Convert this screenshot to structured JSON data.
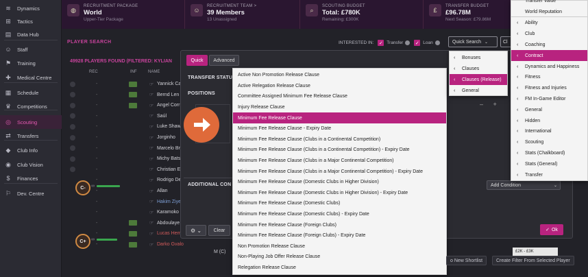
{
  "sidebar": {
    "items": [
      {
        "label": "Dynamics",
        "icon": "dynamics-icon",
        "glyph": "≋"
      },
      {
        "label": "Tactics",
        "icon": "tactics-icon",
        "glyph": "⊞"
      },
      {
        "label": "Data Hub",
        "icon": "data-hub-icon",
        "glyph": "▤"
      },
      {
        "label": "Staff",
        "icon": "staff-icon",
        "glyph": "☺"
      },
      {
        "label": "Training",
        "icon": "training-icon",
        "glyph": "⚑"
      },
      {
        "label": "Medical Centre",
        "icon": "medical-icon",
        "glyph": "✚"
      },
      {
        "label": "Schedule",
        "icon": "schedule-icon",
        "glyph": "▦"
      },
      {
        "label": "Competitions",
        "icon": "trophy-icon",
        "glyph": "♛"
      },
      {
        "label": "Scouting",
        "icon": "scouting-icon",
        "glyph": "◎"
      },
      {
        "label": "Transfers",
        "icon": "transfers-icon",
        "glyph": "⇄"
      },
      {
        "label": "Club Info",
        "icon": "club-info-icon",
        "glyph": "◆"
      },
      {
        "label": "Club Vision",
        "icon": "club-vision-icon",
        "glyph": "◉"
      },
      {
        "label": "Finances",
        "icon": "finances-icon",
        "glyph": "$"
      },
      {
        "label": "Dev. Centre",
        "icon": "dev-centre-icon",
        "glyph": "⚐"
      }
    ]
  },
  "topbar": {
    "recruitment_package": {
      "label": "RECRUITMENT PACKAGE",
      "value": "World",
      "sub": "Upper-Tier Package"
    },
    "recruitment_team": {
      "label": "RECRUITMENT TEAM >",
      "value": "39 Members",
      "sub": "13 Unassigned"
    },
    "scouting_budget": {
      "label": "SCOUTING BUDGET",
      "value": "Total: £780K",
      "sub": "Remaining: £300K"
    },
    "transfer_budget": {
      "label": "TRANSFER BUDGET",
      "value": "£96.78M",
      "sub": "Next Season: £79.86M"
    }
  },
  "player_search": {
    "title": "PLAYER SEARCH",
    "found": "49928 PLAYERS FOUND (FILTERED: KYLIAN",
    "interested_in": "INTERESTED IN:",
    "transfer": "Transfer",
    "loan": "Loan",
    "quick_search": "Quick Search",
    "cl": "Cl",
    "col_rec": "REC",
    "col_inf": "INF",
    "col_name": "NAME",
    "players": [
      "Yannick Ca",
      "Bernd Len",
      "Angel Corr",
      "Saúl",
      "Luke Shaw",
      "Jorginho",
      "Marcelo Br",
      "Michy Bats",
      "Christian E",
      "Rodrigo De",
      "Allan",
      "Hakim Ziye",
      "Karamoko",
      "Abdoulaye",
      "Lucas Hernandez",
      "Darko Gvalo"
    ],
    "badges": [
      "C-",
      "C+"
    ]
  },
  "modal": {
    "tab_quick": "Quick",
    "tab_advanced": "Advanced",
    "transfer_status": "TRANSFER STATU",
    "positions": "POSITIONS",
    "additional": "ADDITIONAL CON",
    "add_condition": "Add Condition",
    "clear": "Clear",
    "ok": "Ok",
    "plusminus": "–  +"
  },
  "dropdown_main": {
    "items": [
      "Active Non Promotion Release Clause",
      "Active Relegation Release Clause",
      "Committee Assigned Minimum Fee Release Clause",
      "Injury Release Clause",
      "Minimum Fee Release Clause",
      "Minimum Fee Release Clause - Expiry Date",
      "Minimum Fee Release Clause (Clubs in a Continental Competition)",
      "Minimum Fee Release Clause (Clubs in a Continental Competition) - Expiry Date",
      "Minimum Fee Release Clause (Clubs in a Major Continental Competition)",
      "Minimum Fee Release Clause (Clubs in a Major Continental Competition) - Expiry Date",
      "Minimum Fee Release Clause (Domestic Clubs in Higher Division)",
      "Minimum Fee Release Clause (Domestic Clubs in Higher Division) - Expiry Date",
      "Minimum Fee Release Clause (Domestic Clubs)",
      "Minimum Fee Release Clause (Domestic Clubs) - Expiry Date",
      "Minimum Fee Release Clause (Foreign Clubs)",
      "Minimum Fee Release Clause (Foreign Clubs) - Expiry Date",
      "Non Promotion Release Clause",
      "Non-Playing Job Offer Release Clause",
      "Relegation Release Clause"
    ],
    "selected": "Minimum Fee Release Clause"
  },
  "dropdown_category": {
    "items": [
      "Bonuses",
      "Clauses",
      "Clauses (Release)",
      "General"
    ],
    "selected": "Clauses (Release)"
  },
  "dropdown_right": {
    "top_items": [
      "Transfer Value",
      "World Reputation"
    ],
    "items": [
      "Ability",
      "Club",
      "Coaching",
      "Contract",
      "Dynamics and Happiness",
      "Fitness",
      "Fitness and Injuries",
      "FM In-Game Editor",
      "General",
      "Hidden",
      "International",
      "Scouting",
      "Stats (Chalkboard)",
      "Stats (General)",
      "Transfer"
    ],
    "selected": "Contract"
  },
  "bottom": {
    "new_shortlist": "o New Shortlist",
    "create_filter": "Create Filter From Selected Player",
    "m_c": "M (C)",
    "wage": "£2K - £3K"
  },
  "colors": {
    "accent": "#b8237f",
    "arrow": "#df6a3a"
  }
}
